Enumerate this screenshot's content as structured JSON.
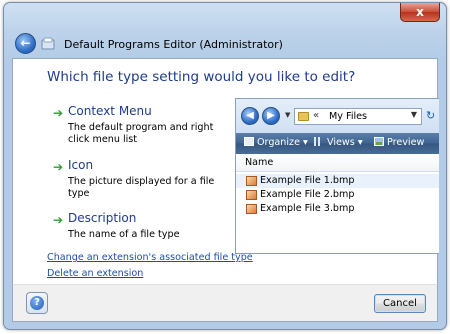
{
  "window": {
    "title": "Default Programs Editor (Administrator)",
    "close_label": "x",
    "back_glyph": "←"
  },
  "main": {
    "heading": "Which file type setting would you like to edit?",
    "options": [
      {
        "icon": "green-arrow-icon",
        "title": "Context Menu",
        "description": "The default program and right click menu list"
      },
      {
        "icon": "green-arrow-icon",
        "title": "Icon",
        "description": "The picture displayed for a file type"
      },
      {
        "icon": "green-arrow-icon",
        "title": "Description",
        "description": "The name of a file type"
      }
    ],
    "links": [
      "Change an extension's associated file type",
      "Delete an extension"
    ]
  },
  "explorer_preview": {
    "address_prefix": "«",
    "address_path": "My Files",
    "toolbar": {
      "organize": "Organize ▾",
      "views": "Views ▾",
      "preview": "Preview"
    },
    "column_header": "Name",
    "files": [
      "Example File 1.bmp",
      "Example File 2.bmp",
      "Example File 3.bmp"
    ]
  },
  "footer": {
    "help_glyph": "?",
    "cancel_label": "Cancel"
  },
  "colors": {
    "heading_blue": "#1f3c8c",
    "link_blue": "#1e4fa8",
    "arrow_green": "#2f9c2f",
    "close_red": "#c94d36"
  }
}
